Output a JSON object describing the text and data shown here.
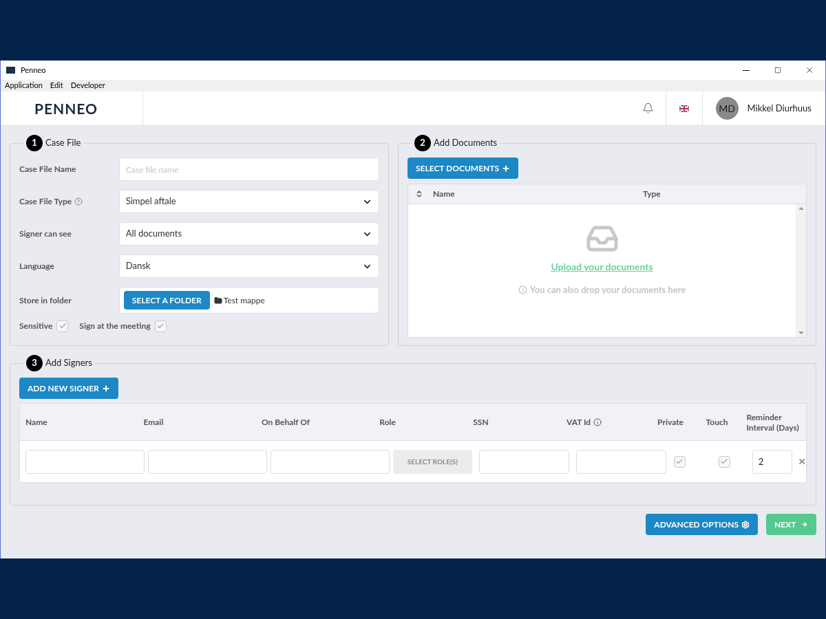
{
  "window": {
    "title": "Penneo"
  },
  "menu": [
    "Application",
    "Edit",
    "Developer"
  ],
  "header": {
    "logo": "PENNEO",
    "user": {
      "initials": "MD",
      "name": "Mikkel Diurhuus"
    }
  },
  "case_file": {
    "step": "1",
    "title": "Case File",
    "fields": [
      {
        "kind": "text",
        "label": "Case File Name",
        "placeholder": "Case file name"
      },
      {
        "kind": "select",
        "label": "Case File Type",
        "help": true,
        "value": "Simpel aftale"
      },
      {
        "kind": "select",
        "label": "Signer can see",
        "value": "All documents"
      },
      {
        "kind": "select",
        "label": "Language",
        "value": "Dansk"
      },
      {
        "kind": "folder",
        "label": "Store in folder",
        "button": "SELECT A FOLDER",
        "value": "Test mappe"
      }
    ],
    "checkboxes": [
      {
        "label": "Sensitive",
        "checked": true
      },
      {
        "label": "Sign at the meeting",
        "checked": true
      }
    ]
  },
  "documents": {
    "step": "2",
    "title": "Add Documents",
    "button": "SELECT DOCUMENTS",
    "columns": [
      "Name",
      "Type"
    ],
    "upload_link": "Upload your documents",
    "hint": "You can also drop your documents here"
  },
  "signers": {
    "step": "3",
    "title": "Add Signers",
    "button": "ADD NEW SIGNER",
    "columns": [
      {
        "label": "Name"
      },
      {
        "label": "Email"
      },
      {
        "label": "On Behalf Of"
      },
      {
        "label": "Role"
      },
      {
        "label": "SSN"
      },
      {
        "label": "VAT Id",
        "info": true
      },
      {
        "label": "Private"
      },
      {
        "label": "Touch"
      },
      {
        "label": "Reminder Interval (Days)"
      }
    ],
    "row": {
      "role_button": "SELECT ROLE(S)",
      "private": {
        "checked": true
      },
      "touch": {
        "checked": true
      },
      "reminder": "2"
    }
  },
  "actions": [
    {
      "kind": "advanced",
      "label": "ADVANCED OPTIONS"
    },
    {
      "kind": "next",
      "label": "NEXT"
    }
  ]
}
